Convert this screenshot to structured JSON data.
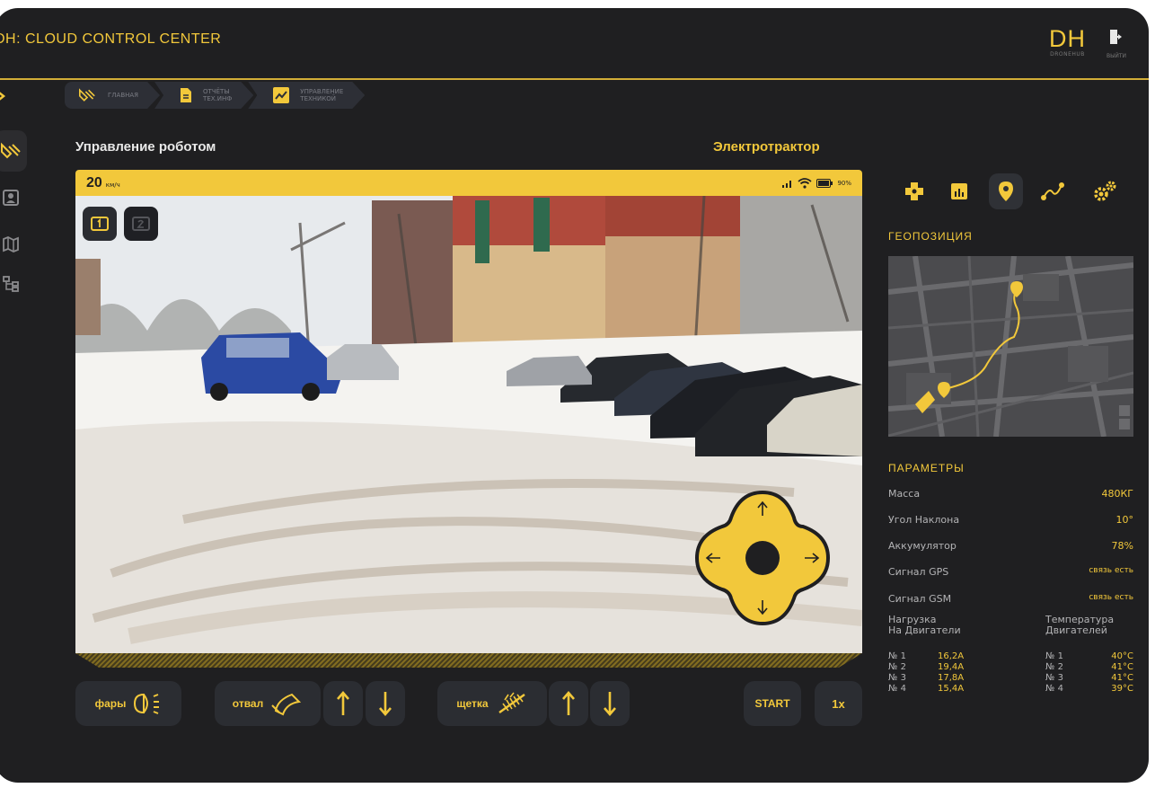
{
  "header": {
    "title": "DH: CLOUD CONTROL CENTER",
    "logo_text": "DH",
    "logo_sub": "DRONEHUB",
    "exit_label": "ВЫЙТИ"
  },
  "breadcrumbs": [
    {
      "label": "ГЛАВНАЯ"
    },
    {
      "label": "ОТЧЁТЫ\nТЕХ.ИНФ"
    },
    {
      "label": "УПРАВЛЕНИЕ\nТЕХНИКОЙ"
    }
  ],
  "panel": {
    "title": "Управление роботом",
    "robot_type": "Электротрактор"
  },
  "status": {
    "speed": "20",
    "speed_unit": "км/ч",
    "battery": "90%"
  },
  "controls": {
    "lights": "фары",
    "blade": "отвал",
    "brush": "щетка",
    "start": "START",
    "speed_mult": "1x"
  },
  "geo": {
    "title": "ГЕОПОЗИЦИЯ"
  },
  "params": {
    "title": "ПАРАМЕТРЫ",
    "rows": [
      {
        "label": "Масса",
        "value": "480КГ"
      },
      {
        "label": "Угол Наклона",
        "value": "10°"
      },
      {
        "label": "Аккумулятор",
        "value": "78%"
      },
      {
        "label": "Сигнал GPS",
        "value": "связь есть"
      },
      {
        "label": "Сигнал GSM",
        "value": "связь есть"
      }
    ],
    "load_header": "Нагрузка\nНа Двигатели",
    "temp_header": "Температура\nДвигателей",
    "motors": [
      {
        "id": "№ 1",
        "load": "16,2А",
        "temp": "40°С"
      },
      {
        "id": "№ 2",
        "load": "19,4А",
        "temp": "41°С"
      },
      {
        "id": "№ 3",
        "load": "17,8А",
        "temp": "41°С"
      },
      {
        "id": "№ 4",
        "load": "15,4А",
        "temp": "39°С"
      }
    ]
  },
  "colors": {
    "accent": "#f2c83b",
    "background": "#1f1f21",
    "surface": "#2b2d32"
  }
}
